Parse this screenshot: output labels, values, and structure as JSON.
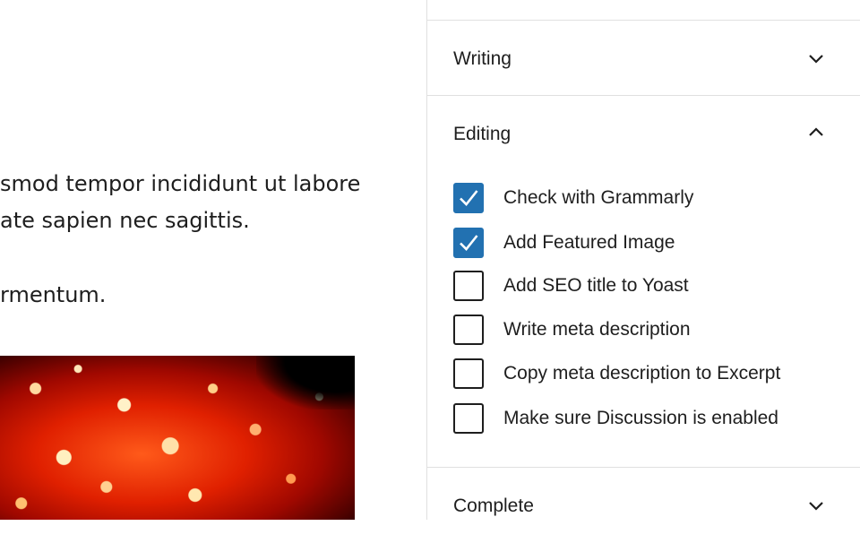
{
  "editor": {
    "paragraph_1": "smod tempor incididunt ut labore\nate sapien nec sagittis.",
    "paragraph_2": "rmentum."
  },
  "sidebar": {
    "sections": {
      "writing": {
        "title": "Writing",
        "state": "collapsed"
      },
      "editing": {
        "title": "Editing",
        "state": "expanded"
      },
      "complete": {
        "title": "Complete",
        "state": "collapsed"
      }
    },
    "editing_items": [
      {
        "label": "Check with Grammarly",
        "checked": true
      },
      {
        "label": "Add Featured Image",
        "checked": true
      },
      {
        "label": "Add SEO title to Yoast",
        "checked": false
      },
      {
        "label": "Write meta description",
        "checked": false
      },
      {
        "label": "Copy meta description to Excerpt",
        "checked": false
      },
      {
        "label": "Make sure Discussion is enabled",
        "checked": false
      }
    ]
  },
  "colors": {
    "checkbox_checked": "#2271b1",
    "border": "#e0e0e0",
    "text": "#1e1e1e"
  },
  "icons": {
    "expand": "chevron-down-icon",
    "collapse": "chevron-up-icon",
    "check": "checkmark-icon"
  }
}
